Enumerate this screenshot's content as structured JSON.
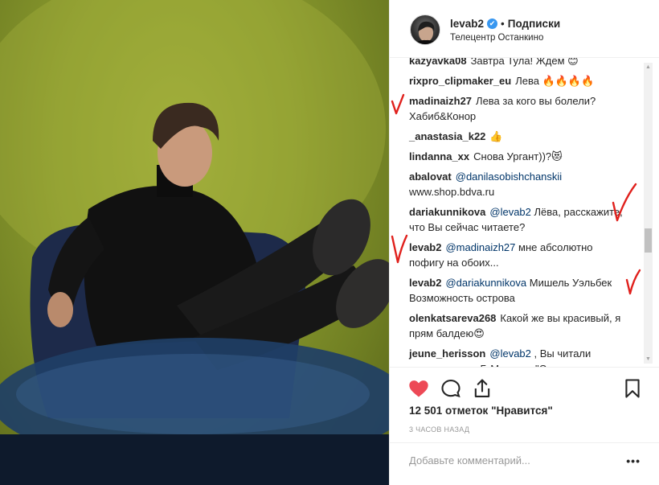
{
  "post": {
    "username": "levab2",
    "verified_mark": "✔",
    "separator": "•",
    "follow_label": "Подписки",
    "location": "Телецентр Останкино"
  },
  "comments": [
    {
      "user": "kazyavka08",
      "parts": [
        {
          "t": "Завтра Тула! Ждём 😊"
        }
      ]
    },
    {
      "user": "rixpro_clipmaker_eu",
      "parts": [
        {
          "t": "Лева 🔥🔥🔥🔥"
        }
      ]
    },
    {
      "user": "madinaizh27",
      "parts": [
        {
          "t": "Лева за кого вы болели? Хабиб&Конор"
        }
      ]
    },
    {
      "user": "_anastasia_k22",
      "parts": [
        {
          "t": "👍"
        }
      ]
    },
    {
      "user": "lindanna_xx",
      "parts": [
        {
          "t": "Снова Ургант))?😻"
        }
      ]
    },
    {
      "user": "abalovat",
      "parts": [
        {
          "t": "@danilasobishchanskii",
          "m": true
        },
        {
          "t": " www.shop.bdva.ru"
        }
      ]
    },
    {
      "user": "dariakunnikova",
      "parts": [
        {
          "t": "@levab2",
          "m": true
        },
        {
          "t": " Лёва, расскажите, что Вы сейчас читаете?"
        }
      ]
    },
    {
      "user": "levab2",
      "parts": [
        {
          "t": "@madinaizh27",
          "m": true
        },
        {
          "t": " мне абсолютно пофигу на обоих..."
        }
      ]
    },
    {
      "user": "levab2",
      "parts": [
        {
          "t": "@dariakunnikova",
          "m": true
        },
        {
          "t": " Мишель Уэльбек Возможность острова"
        }
      ]
    },
    {
      "user": "olenkatsareva268",
      "parts": [
        {
          "t": "Какой же вы красивый, я прям балдею😍"
        }
      ]
    },
    {
      "user": "jeune_herisson",
      "parts": [
        {
          "t": "@levab2",
          "m": true
        },
        {
          "t": " , Вы читали произведение Г. Маркеса \"Сто лет одиночества\"? Если читали, Вам понравилось?"
        }
      ]
    }
  ],
  "actions": {
    "likes_text": "12 501 отметок \"Нравится\"",
    "time_text": "3 ЧАСОВ НАЗАД",
    "add_comment_placeholder": "Добавьте комментарий...",
    "more_label": "•••"
  },
  "scrollbar": {
    "up": "▲",
    "down": "▼"
  },
  "colors": {
    "like_red": "#ed4956",
    "mention_blue": "#003569",
    "verified_blue": "#3897f0",
    "checkmark_red": "#e0201c"
  }
}
